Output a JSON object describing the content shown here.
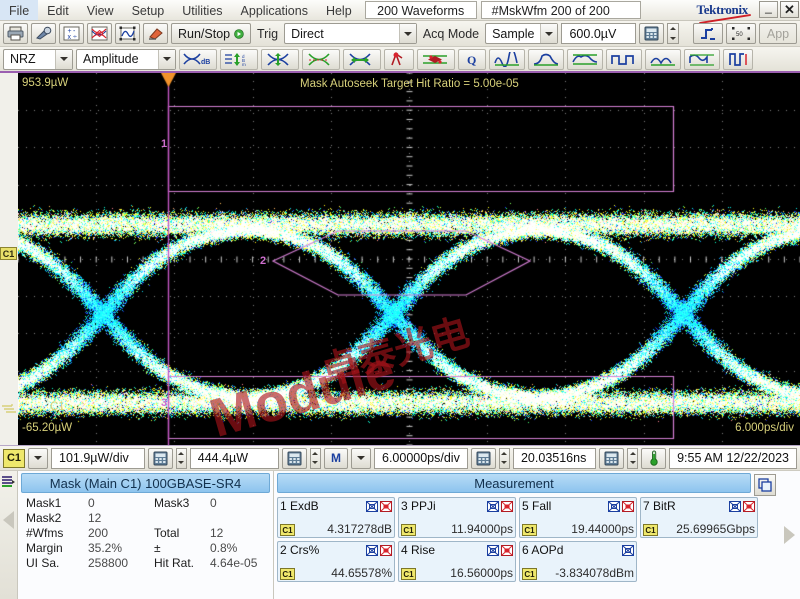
{
  "menubar": {
    "items": [
      "File",
      "Edit",
      "View",
      "Setup",
      "Utilities",
      "Applications",
      "Help"
    ],
    "waveform_count": "200 Waveforms",
    "mask_wfm": "#MskWfm  200 of 200",
    "brand": "Tektronix",
    "minimize_label": "_",
    "close_label": "✕"
  },
  "toolbar1": {
    "icons": [
      "print-icon",
      "tools-icon",
      "math-icon",
      "eye-diagram-icon",
      "waveform-icon",
      "eraser-icon"
    ],
    "runstop_label": "Run/Stop",
    "trig_label": "Trig",
    "trig_value": "Direct",
    "acq_mode_label": "Acq Mode",
    "acq_mode_value": "Sample",
    "level_value": "600.0µV",
    "calculator_icon": "calculator-icon",
    "edge_icon": "edge-trigger-icon",
    "resize_icon": "resize-50-icon",
    "app_label": "App"
  },
  "toolbar2": {
    "signal_type": "NRZ",
    "measure_category": "Amplitude",
    "icons": [
      "extinction-ratio-icon",
      "oma-icon",
      "eye-height-icon",
      "crossing-pct-icon",
      "eye-width-icon",
      "jitter-icon",
      "mask-hits-icon",
      "q-factor-icon",
      "rise-fall-icon",
      "overshoot-icon",
      "undershoot-icon",
      "period-icon",
      "pulse-width-icon",
      "duty-cycle-icon",
      "bit-rate-icon"
    ]
  },
  "scope": {
    "vert_top_label": "953.9µW",
    "vert_bottom_label": "-65.20µW",
    "center_banner": "Mask Autoseek Target Hit Ratio = 5.00e-05",
    "channel_label": "C1",
    "channel_tag": "C1",
    "horiz_label": "6.000ps/div",
    "mask_region_numbers": [
      "1",
      "2",
      "3"
    ],
    "watermark_1": "卓泰光电",
    "watermark_2": "Module"
  },
  "controls": {
    "channel": "C1",
    "vert_scale": "101.9µW/div",
    "vert_offset": "444.4µW",
    "horiz_mode": "M",
    "horiz_scale": "6.00000ps/div",
    "horiz_position": "20.03516ns",
    "thermometer_icon": "temperature-icon",
    "datetime": "9:55 AM 12/22/2023"
  },
  "mask_panel": {
    "title": "Mask (Main  C1) 100GBASE-SR4",
    "rows": [
      {
        "l1": "Mask1",
        "v1": "0",
        "l2": "Mask3",
        "v2": "0"
      },
      {
        "l1": "Mask2",
        "v1": "12",
        "l2": "",
        "v2": ""
      },
      {
        "l1": "#Wfms",
        "v1": "200",
        "l2": "Total",
        "v2": "12"
      },
      {
        "l1": "Margin",
        "v1": "35.2%",
        "l2": "±",
        "v2": "0.8%"
      },
      {
        "l1": "UI Sa.",
        "v1": "258800",
        "l2": "Hit Rat.",
        "v2": "4.64e-05"
      }
    ]
  },
  "measurement_panel": {
    "title": "Measurement",
    "copy_icon": "duplicate-icon",
    "cards": [
      {
        "index": "1",
        "name": "ExdB",
        "chip": "C1",
        "value": "4.317278dB",
        "icons": [
          "mask-icon",
          "stat-icon"
        ]
      },
      {
        "index": "2",
        "name": "Crs%",
        "chip": "C1",
        "value": "44.65578%",
        "icons": [
          "mask-icon",
          "stat-icon"
        ]
      },
      {
        "index": "3",
        "name": "PPJi",
        "chip": "C1",
        "value": "11.94000ps",
        "icons": [
          "mask-icon",
          "stat-icon"
        ]
      },
      {
        "index": "4",
        "name": "Rise",
        "chip": "C1",
        "value": "16.56000ps",
        "icons": [
          "mask-icon",
          "stat-icon"
        ]
      },
      {
        "index": "5",
        "name": "Fall",
        "chip": "C1",
        "value": "19.44000ps",
        "icons": [
          "mask-icon",
          "stat-icon"
        ]
      },
      {
        "index": "6",
        "name": "AOPd",
        "chip": "C1",
        "value": "-3.834078dBm",
        "icons": [
          "mask-icon"
        ]
      },
      {
        "index": "7",
        "name": "BitR",
        "chip": "C1",
        "value": "25.69965Gbps",
        "icons": [
          "mask-icon",
          "stat-icon"
        ]
      }
    ]
  },
  "colors": {
    "accent_blue": "#8dc4ee",
    "mask_purple": "#d57fd5",
    "channel_yellow": "#efe86c",
    "screen_text": "#d7d07a",
    "brand": "#18388c"
  }
}
